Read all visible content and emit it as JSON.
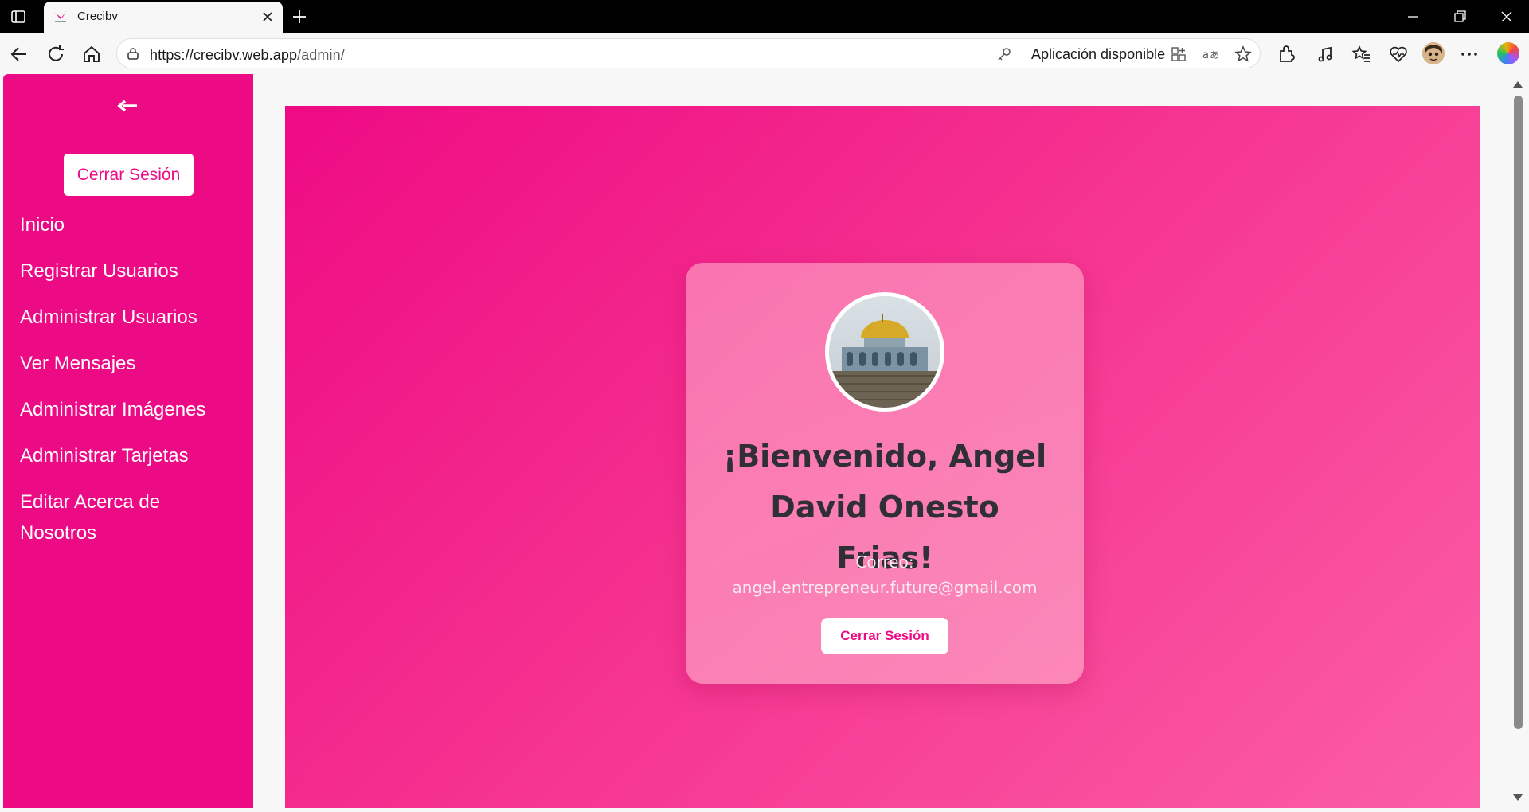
{
  "browser": {
    "tab_title": "Crecibv",
    "url_host": "https://crecibv.web.app",
    "url_path": "/admin/",
    "app_available": "Aplicación disponible"
  },
  "sidebar": {
    "logout_label": "Cerrar Sesión",
    "items": [
      {
        "label": "Inicio"
      },
      {
        "label": "Registrar Usuarios"
      },
      {
        "label": "Administrar Usuarios"
      },
      {
        "label": "Ver Mensajes"
      },
      {
        "label": "Administrar Imágenes"
      },
      {
        "label": "Administrar Tarjetas"
      },
      {
        "label": "Editar Acerca de Nosotros"
      }
    ]
  },
  "profile": {
    "welcome": "¡Bienvenido, Angel David Onesto Frias!",
    "email_label": "Correo:",
    "email": "angel.entrepreneur.future@gmail.com",
    "logout_label": "Cerrar Sesión"
  },
  "colors": {
    "brand": "#ed0a85",
    "heading": "#2f2f35"
  }
}
